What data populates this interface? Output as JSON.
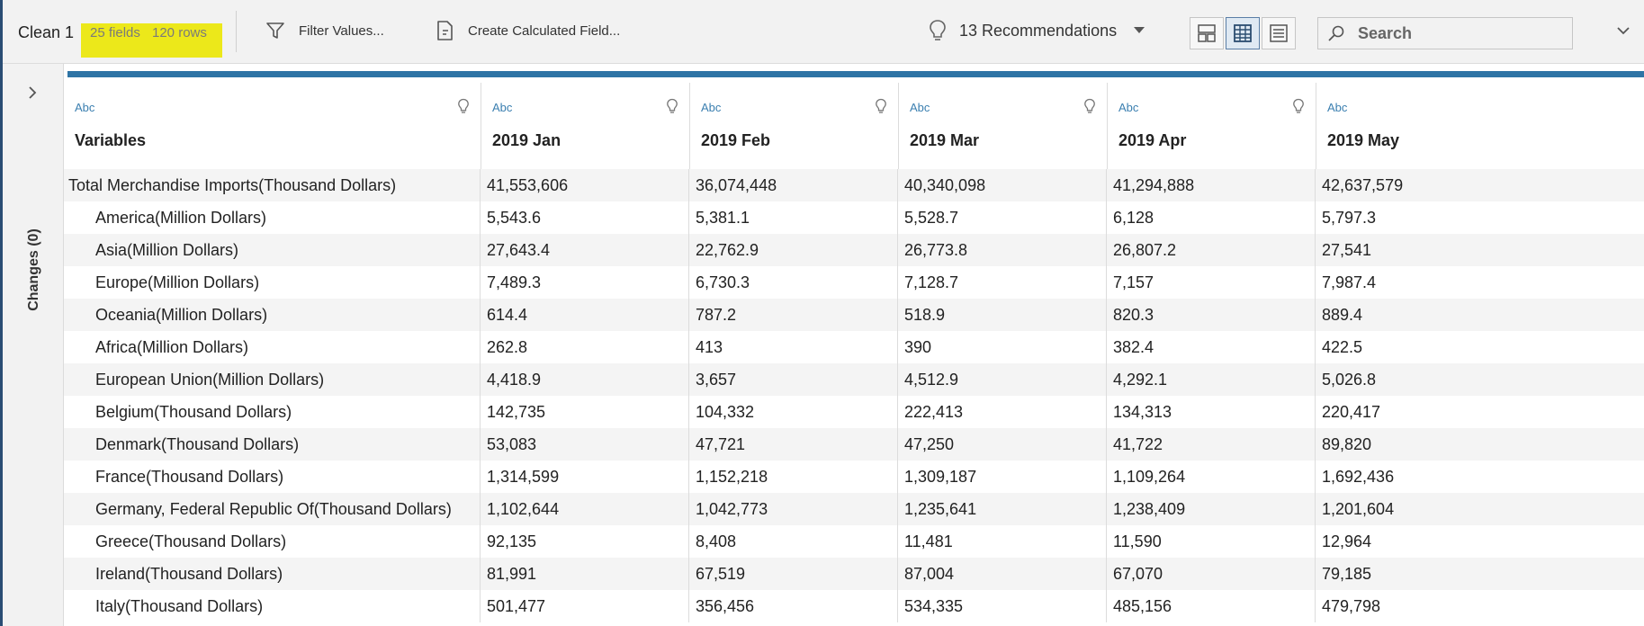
{
  "toolbar": {
    "title": "Clean 1",
    "fields": "25 fields",
    "rows": "120 rows",
    "filter_label": "Filter Values...",
    "calc_label": "Create Calculated Field...",
    "recommendations_label": "13 Recommendations",
    "search_placeholder": "Search",
    "highlight_color": "#ece81a"
  },
  "sidebar": {
    "changes_label": "Changes (0)"
  },
  "table": {
    "type_label": "Abc",
    "columns": [
      "Variables",
      "2019 Jan",
      "2019 Feb",
      "2019 Mar",
      "2019 Apr",
      "2019 May"
    ],
    "rows": [
      [
        "Total Merchandise Imports(Thousand Dollars)",
        "41,553,606",
        "36,074,448",
        "40,340,098",
        "41,294,888",
        "42,637,579"
      ],
      [
        "America(Million Dollars)",
        "5,543.6",
        "5,381.1",
        "5,528.7",
        "6,128",
        "5,797.3"
      ],
      [
        "Asia(Million Dollars)",
        "27,643.4",
        "22,762.9",
        "26,773.8",
        "26,807.2",
        "27,541"
      ],
      [
        "Europe(Million Dollars)",
        "7,489.3",
        "6,730.3",
        "7,128.7",
        "7,157",
        "7,987.4"
      ],
      [
        "Oceania(Million Dollars)",
        "614.4",
        "787.2",
        "518.9",
        "820.3",
        "889.4"
      ],
      [
        "Africa(Million Dollars)",
        "262.8",
        "413",
        "390",
        "382.4",
        "422.5"
      ],
      [
        "European Union(Million Dollars)",
        "4,418.9",
        "3,657",
        "4,512.9",
        "4,292.1",
        "5,026.8"
      ],
      [
        "Belgium(Thousand Dollars)",
        "142,735",
        "104,332",
        "222,413",
        "134,313",
        "220,417"
      ],
      [
        "Denmark(Thousand Dollars)",
        "53,083",
        "47,721",
        "47,250",
        "41,722",
        "89,820"
      ],
      [
        "France(Thousand Dollars)",
        "1,314,599",
        "1,152,218",
        "1,309,187",
        "1,109,264",
        "1,692,436"
      ],
      [
        "Germany, Federal Republic Of(Thousand Dollars)",
        "1,102,644",
        "1,042,773",
        "1,235,641",
        "1,238,409",
        "1,201,604"
      ],
      [
        "Greece(Thousand Dollars)",
        "92,135",
        "8,408",
        "11,481",
        "11,590",
        "12,964"
      ],
      [
        "Ireland(Thousand Dollars)",
        "81,991",
        "67,519",
        "87,004",
        "67,070",
        "79,185"
      ],
      [
        "Italy(Thousand Dollars)",
        "501,477",
        "356,456",
        "534,335",
        "485,156",
        "479,798"
      ]
    ]
  }
}
